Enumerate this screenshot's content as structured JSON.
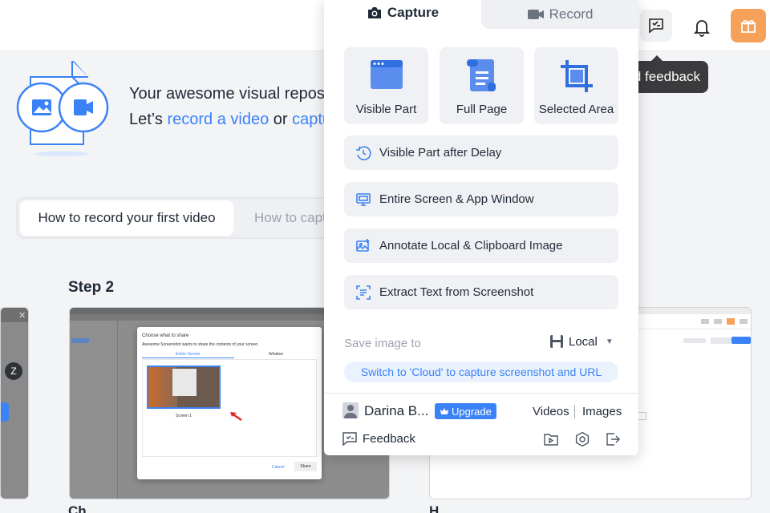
{
  "header": {
    "tooltip": "d feedback"
  },
  "hero": {
    "line1": "Your awesome visual reposit",
    "line2_prefix": "Let’s ",
    "line2_link1": "record a video",
    "line2_mid": " or ",
    "line2_link2": "captur"
  },
  "tutorial": {
    "tabs": [
      {
        "label": "How to record your first video",
        "active": true
      },
      {
        "label": "How to capt",
        "active": false
      }
    ],
    "step_title": "Step 2",
    "dialog": {
      "title": "Choose what to share",
      "subtitle": "Awesome Screenshot wants to share the contents of your screen.",
      "tab_entire": "Entire Screen",
      "tab_window": "Window",
      "thumb_label": "Screen 1",
      "cancel": "Cancel",
      "share": "Share"
    },
    "bottom_left": "Ch",
    "bottom_right": "H"
  },
  "popup": {
    "tabs": {
      "capture": "Capture",
      "record": "Record"
    },
    "tiles": [
      {
        "label": "Visible Part",
        "icon": "browser-window-icon"
      },
      {
        "label": "Full Page",
        "icon": "scroll-page-icon"
      },
      {
        "label": "Selected Area",
        "icon": "crop-icon"
      }
    ],
    "options": [
      {
        "label": "Visible Part after Delay",
        "icon": "timer-icon"
      },
      {
        "label": "Entire Screen & App Window",
        "icon": "monitor-icon"
      },
      {
        "label": "Annotate Local & Clipboard Image",
        "icon": "image-edit-icon"
      },
      {
        "label": "Extract Text from Screenshot",
        "icon": "text-scan-icon"
      }
    ],
    "save": {
      "label": "Save image to",
      "value": "Local",
      "cloud_hint": "Switch to 'Cloud' to capture screenshot and URL"
    },
    "footer": {
      "user_name": "Darina B...",
      "upgrade": "Upgrade",
      "videos": "Videos",
      "images": "Images",
      "feedback": "Feedback"
    },
    "accent_color": "#3b82f6"
  }
}
